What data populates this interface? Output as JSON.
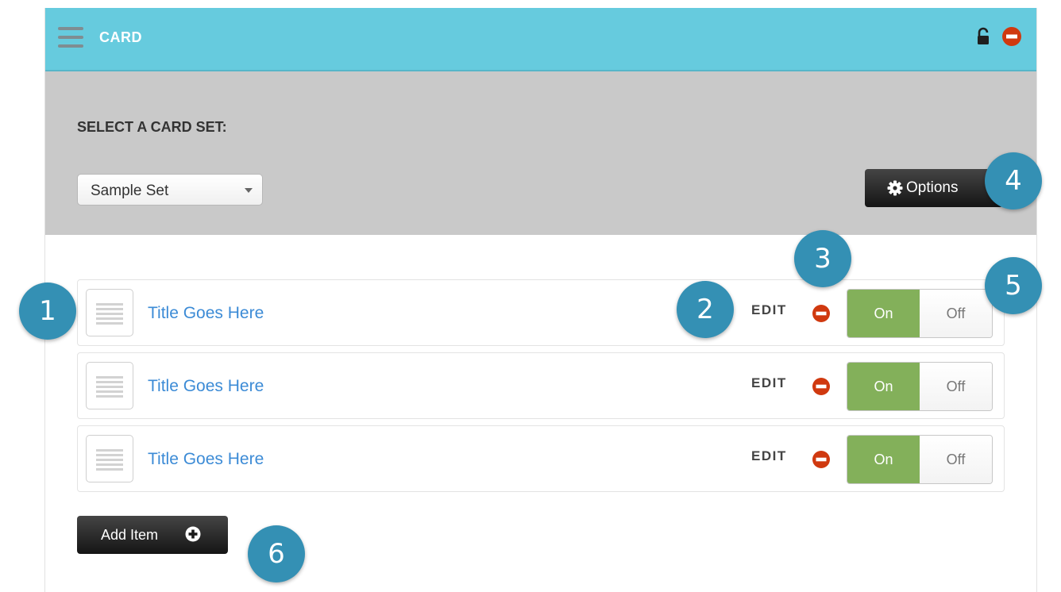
{
  "header": {
    "title": "CARD",
    "icons": [
      "hamburger-menu-icon",
      "unlock-icon",
      "remove-icon"
    ]
  },
  "card_set": {
    "label": "SELECT A CARD SET:",
    "selected": "Sample Set",
    "options_label": "Options"
  },
  "items": [
    {
      "title": "Title Goes Here",
      "edit": "EDIT",
      "on": "On",
      "off": "Off",
      "state": "On"
    },
    {
      "title": "Title Goes Here",
      "edit": "EDIT",
      "on": "On",
      "off": "Off",
      "state": "On"
    },
    {
      "title": "Title Goes Here",
      "edit": "EDIT",
      "on": "On",
      "off": "Off",
      "state": "On"
    }
  ],
  "add_item_label": "Add Item",
  "callouts": [
    "1",
    "2",
    "3",
    "4",
    "5",
    "6"
  ],
  "colors": {
    "header": "#66cbde",
    "select_area": "#c9c9c9",
    "title_link": "#3c8bd6",
    "toggle_on": "#83b05a",
    "remove": "#d0390f",
    "callout": "#3490b4"
  }
}
